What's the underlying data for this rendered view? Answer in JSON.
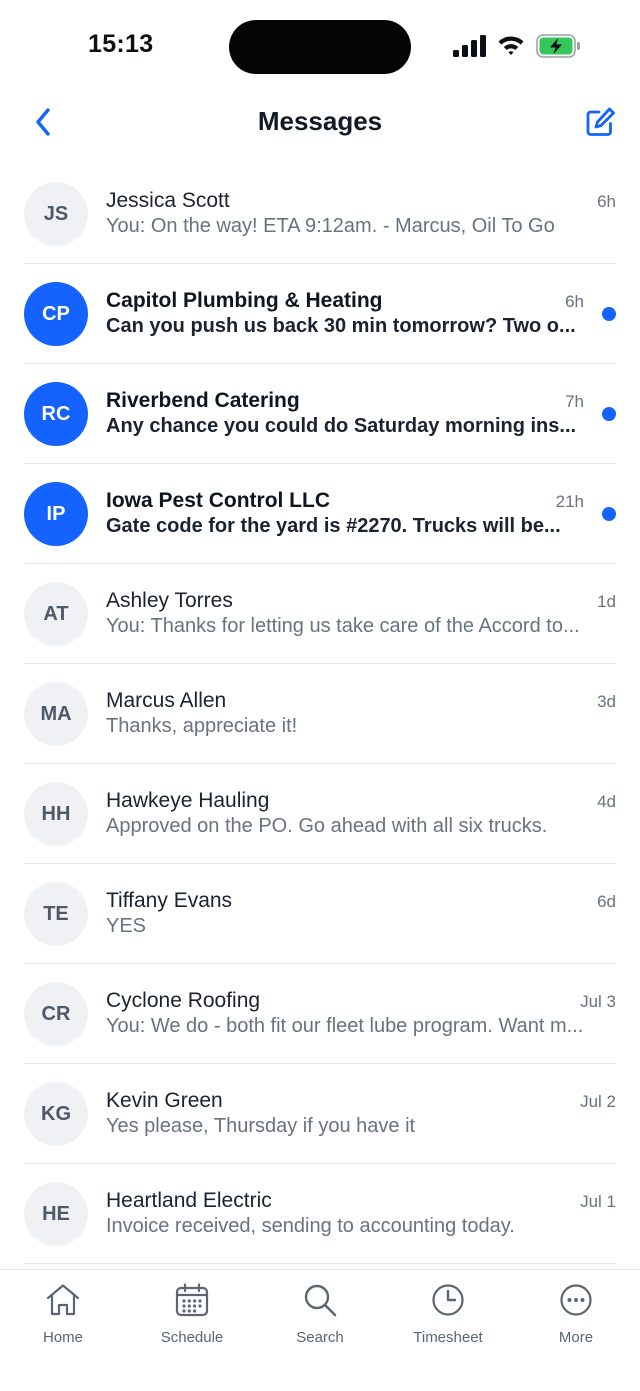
{
  "status_bar": {
    "time": "15:13"
  },
  "nav": {
    "title": "Messages"
  },
  "messages": [
    {
      "initials": "JS",
      "name": "Jessica Scott",
      "time": "6h",
      "preview": "You: On the way! ETA 9:12am. - Marcus, Oil To Go",
      "unread": false
    },
    {
      "initials": "CP",
      "name": "Capitol Plumbing & Heating",
      "time": "6h",
      "preview": "Can you push us back 30 min tomorrow? Two o...",
      "unread": true
    },
    {
      "initials": "RC",
      "name": "Riverbend Catering",
      "time": "7h",
      "preview": "Any chance you could do Saturday morning ins...",
      "unread": true
    },
    {
      "initials": "IP",
      "name": "Iowa Pest Control LLC",
      "time": "21h",
      "preview": "Gate code for the yard is #2270. Trucks will be...",
      "unread": true
    },
    {
      "initials": "AT",
      "name": "Ashley Torres",
      "time": "1d",
      "preview": "You: Thanks for letting us take care of the Accord to...",
      "unread": false
    },
    {
      "initials": "MA",
      "name": "Marcus Allen",
      "time": "3d",
      "preview": "Thanks, appreciate it!",
      "unread": false
    },
    {
      "initials": "HH",
      "name": "Hawkeye Hauling",
      "time": "4d",
      "preview": "Approved on the PO. Go ahead with all six trucks.",
      "unread": false
    },
    {
      "initials": "TE",
      "name": "Tiffany Evans",
      "time": "6d",
      "preview": "YES",
      "unread": false
    },
    {
      "initials": "CR",
      "name": "Cyclone Roofing",
      "time": "Jul 3",
      "preview": "You: We do - both fit our fleet lube program. Want m...",
      "unread": false
    },
    {
      "initials": "KG",
      "name": "Kevin Green",
      "time": "Jul 2",
      "preview": "Yes please, Thursday if you have it",
      "unread": false
    },
    {
      "initials": "HE",
      "name": "Heartland Electric",
      "time": "Jul 1",
      "preview": "Invoice received, sending to accounting today.",
      "unread": false
    }
  ],
  "tabs": [
    {
      "label": "Home",
      "icon": "home-icon"
    },
    {
      "label": "Schedule",
      "icon": "calendar-icon"
    },
    {
      "label": "Search",
      "icon": "search-icon"
    },
    {
      "label": "Timesheet",
      "icon": "clock-icon"
    },
    {
      "label": "More",
      "icon": "more-icon"
    }
  ],
  "colors": {
    "accent": "#1463ff",
    "battery": "#34c759"
  }
}
